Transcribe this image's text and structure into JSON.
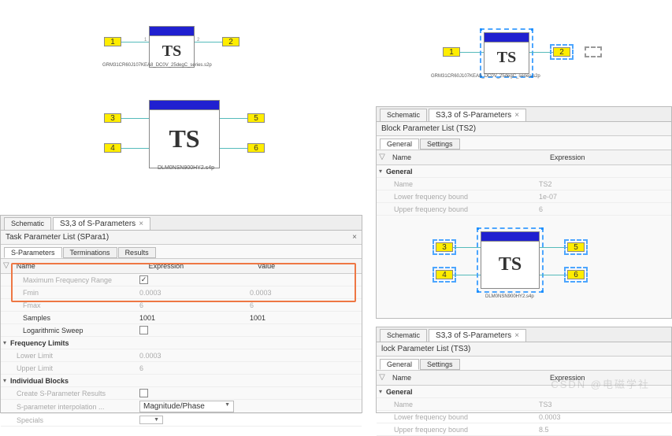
{
  "watermark": "CSDN @电磁学社",
  "tl": {
    "ts": "TS",
    "cap": "GRM31CR60J107KEA8_DC0V_25degC_series.s2p",
    "p1": "1",
    "p2": "2",
    "pin1": "1",
    "pin2": "2"
  },
  "ml": {
    "ts": "TS",
    "cap": "DLM0NSN900HY2.s4p",
    "p3": "3",
    "p4": "4",
    "p5": "5",
    "p6": "6"
  },
  "tr": {
    "ts": "TS",
    "cap": "GRM31CR60J107KEA8_DC0V_25degC_series.s2p",
    "p1": "1",
    "p2": "2"
  },
  "mr": {
    "ts": "TS",
    "cap": "DLM0NSN900HY2.s4p",
    "p3": "3",
    "p4": "4",
    "p5": "5",
    "p6": "6"
  },
  "tabs": {
    "schem": "Schematic",
    "sp": "S3,3 of S-Parameters"
  },
  "task": {
    "title": "Task Parameter List (SPara1)",
    "subs": [
      "S-Parameters",
      "Terminations",
      "Results"
    ],
    "cols": [
      "Name",
      "Expression",
      "Value"
    ],
    "rows": {
      "maxfr": "Maximum Frequency Range",
      "fmin": "Fmin",
      "fmax": "Fmax",
      "samp": "Samples",
      "log": "Logarithmic Sweep"
    },
    "vals": {
      "fmin": "0.0003",
      "fmax": "6",
      "samp": "1001"
    },
    "grp_fl": "Frequency Limits",
    "ll": "Lower Limit",
    "ul": "Upper Limit",
    "llv": "0.0003",
    "ulv": "6",
    "grp_ib": "Individual Blocks",
    "csr": "Create S-Parameter Results",
    "spi": "S-parameter interpolation ...",
    "spi_v": "Magnitude/Phase",
    "spec": "Specials"
  },
  "bp1": {
    "title": "Block Parameter List (TS2)",
    "subs": [
      "General",
      "Settings"
    ],
    "cols": [
      "Name",
      "Expression"
    ],
    "grp": "General",
    "name": "Name",
    "namev": "TS2",
    "lfb": "Lower frequency bound",
    "lfbv": "1e-07",
    "ufb": "Upper frequency bound",
    "ufbv": "6"
  },
  "bp2": {
    "title": "lock Parameter List (TS3)",
    "subs": [
      "General",
      "Settings"
    ],
    "cols": [
      "Name",
      "Expression"
    ],
    "grp": "General",
    "name": "Name",
    "namev": "TS3",
    "lfb": "Lower frequency bound",
    "lfbv": "0.0003",
    "ufb": "Upper frequency bound",
    "ufbv": "8.5"
  }
}
